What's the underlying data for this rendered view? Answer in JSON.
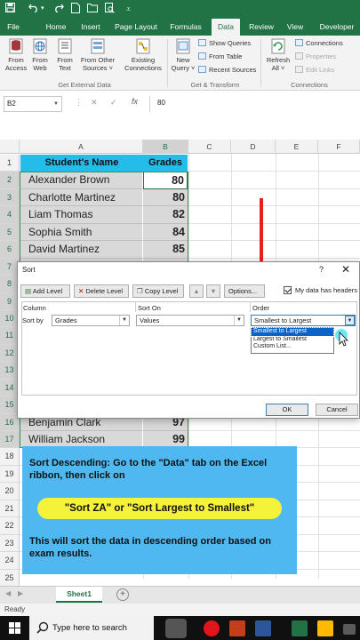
{
  "quick_access": {
    "save_icon": "save-icon",
    "undo_icon": "undo-icon",
    "redo_icon": "redo-icon"
  },
  "ribbon_tabs": [
    "File",
    "Home",
    "Insert",
    "Page Layout",
    "Formulas",
    "Data",
    "Review",
    "View",
    "Developer"
  ],
  "active_tab": "Data",
  "ribbon": {
    "from_access": [
      "From",
      "Access"
    ],
    "from_web": [
      "From",
      "Web"
    ],
    "from_text": [
      "From",
      "Text"
    ],
    "from_other": [
      "From Other",
      "Sources ˅"
    ],
    "existing": [
      "Existing",
      "Connections"
    ],
    "new_query": [
      "New",
      "Query ˅"
    ],
    "show_queries": "Show Queries",
    "from_table": "From Table",
    "recent_sources": "Recent Sources",
    "refresh": [
      "Refresh",
      "All ˅"
    ],
    "connections": "Connections",
    "properties": "Properties",
    "edit_links": "Edit Links",
    "group_external": "Get External Data",
    "group_transform": "Get & Transform",
    "group_connections": "Connections"
  },
  "formula_bar": {
    "name_box": "B2",
    "fx_label": "fx",
    "value": "80"
  },
  "columns": [
    "A",
    "B",
    "C",
    "D",
    "E",
    "F"
  ],
  "rows": [
    "1",
    "2",
    "3",
    "4",
    "5",
    "6",
    "7",
    "8",
    "9",
    "10",
    "11",
    "12",
    "13",
    "14",
    "15",
    "16",
    "17",
    "18",
    "19",
    "20",
    "21",
    "22",
    "23",
    "24",
    "25"
  ],
  "table": {
    "header_name": "Student's Name",
    "header_grades": "Grades",
    "top_rows": [
      {
        "name": "Alexander Brown",
        "grade": "80"
      },
      {
        "name": "Charlotte Martinez",
        "grade": "80"
      },
      {
        "name": "Liam Thomas",
        "grade": "82"
      },
      {
        "name": "Sophia Smith",
        "grade": "84"
      },
      {
        "name": "David Martinez",
        "grade": "85"
      }
    ],
    "bottom_rows": [
      {
        "name": "Benjamin Clark",
        "grade": "97"
      },
      {
        "name": "William Jackson",
        "grade": "99"
      }
    ]
  },
  "sort_dialog": {
    "title": "Sort",
    "help": "?",
    "close": "✕",
    "add_level": "Add Level",
    "delete_level": "Delete Level",
    "copy_level": "Copy Level",
    "options": "Options...",
    "my_data_headers": "My data has headers",
    "col_header_column": "Column",
    "col_header_sort_on": "Sort On",
    "col_header_order": "Order",
    "sort_by_label": "Sort by",
    "sort_by_value": "Grades",
    "sort_on_value": "Values",
    "order_value": "Smallest to Largest",
    "order_options": [
      "Smallest to Largest",
      "Largest to Smallest",
      "Custom List..."
    ],
    "ok": "OK",
    "cancel": "Cancel"
  },
  "info_box": {
    "line1": "Sort Descending: Go to the \"Data\" tab on the Excel ribbon, then click on",
    "highlight": "\"Sort ZA\" or \"Sort Largest to Smallest\"",
    "line2": "This will sort the data in descending order based on exam results."
  },
  "sheet_tab": "Sheet1",
  "add_sheet": "+",
  "status": "Ready",
  "taskbar": {
    "search_placeholder": "Type here to search"
  },
  "colors": {
    "excel_green": "#217346",
    "header_fill": "#24bce8",
    "info_box": "#4fb8f0",
    "highlight": "#f5f23a",
    "arrow_red": "#e8201c"
  }
}
